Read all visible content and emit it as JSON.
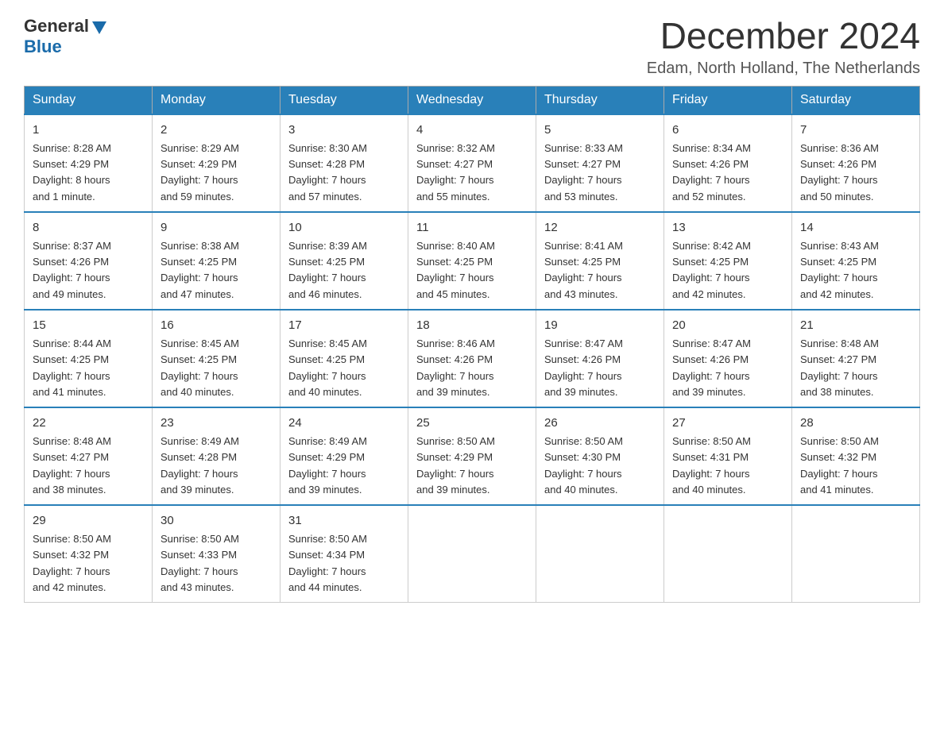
{
  "header": {
    "logo_general": "General",
    "logo_blue": "Blue",
    "month_title": "December 2024",
    "location": "Edam, North Holland, The Netherlands"
  },
  "columns": [
    "Sunday",
    "Monday",
    "Tuesday",
    "Wednesday",
    "Thursday",
    "Friday",
    "Saturday"
  ],
  "weeks": [
    [
      {
        "day": "1",
        "sunrise": "Sunrise: 8:28 AM",
        "sunset": "Sunset: 4:29 PM",
        "daylight": "Daylight: 8 hours",
        "daylight2": "and 1 minute."
      },
      {
        "day": "2",
        "sunrise": "Sunrise: 8:29 AM",
        "sunset": "Sunset: 4:29 PM",
        "daylight": "Daylight: 7 hours",
        "daylight2": "and 59 minutes."
      },
      {
        "day": "3",
        "sunrise": "Sunrise: 8:30 AM",
        "sunset": "Sunset: 4:28 PM",
        "daylight": "Daylight: 7 hours",
        "daylight2": "and 57 minutes."
      },
      {
        "day": "4",
        "sunrise": "Sunrise: 8:32 AM",
        "sunset": "Sunset: 4:27 PM",
        "daylight": "Daylight: 7 hours",
        "daylight2": "and 55 minutes."
      },
      {
        "day": "5",
        "sunrise": "Sunrise: 8:33 AM",
        "sunset": "Sunset: 4:27 PM",
        "daylight": "Daylight: 7 hours",
        "daylight2": "and 53 minutes."
      },
      {
        "day": "6",
        "sunrise": "Sunrise: 8:34 AM",
        "sunset": "Sunset: 4:26 PM",
        "daylight": "Daylight: 7 hours",
        "daylight2": "and 52 minutes."
      },
      {
        "day": "7",
        "sunrise": "Sunrise: 8:36 AM",
        "sunset": "Sunset: 4:26 PM",
        "daylight": "Daylight: 7 hours",
        "daylight2": "and 50 minutes."
      }
    ],
    [
      {
        "day": "8",
        "sunrise": "Sunrise: 8:37 AM",
        "sunset": "Sunset: 4:26 PM",
        "daylight": "Daylight: 7 hours",
        "daylight2": "and 49 minutes."
      },
      {
        "day": "9",
        "sunrise": "Sunrise: 8:38 AM",
        "sunset": "Sunset: 4:25 PM",
        "daylight": "Daylight: 7 hours",
        "daylight2": "and 47 minutes."
      },
      {
        "day": "10",
        "sunrise": "Sunrise: 8:39 AM",
        "sunset": "Sunset: 4:25 PM",
        "daylight": "Daylight: 7 hours",
        "daylight2": "and 46 minutes."
      },
      {
        "day": "11",
        "sunrise": "Sunrise: 8:40 AM",
        "sunset": "Sunset: 4:25 PM",
        "daylight": "Daylight: 7 hours",
        "daylight2": "and 45 minutes."
      },
      {
        "day": "12",
        "sunrise": "Sunrise: 8:41 AM",
        "sunset": "Sunset: 4:25 PM",
        "daylight": "Daylight: 7 hours",
        "daylight2": "and 43 minutes."
      },
      {
        "day": "13",
        "sunrise": "Sunrise: 8:42 AM",
        "sunset": "Sunset: 4:25 PM",
        "daylight": "Daylight: 7 hours",
        "daylight2": "and 42 minutes."
      },
      {
        "day": "14",
        "sunrise": "Sunrise: 8:43 AM",
        "sunset": "Sunset: 4:25 PM",
        "daylight": "Daylight: 7 hours",
        "daylight2": "and 42 minutes."
      }
    ],
    [
      {
        "day": "15",
        "sunrise": "Sunrise: 8:44 AM",
        "sunset": "Sunset: 4:25 PM",
        "daylight": "Daylight: 7 hours",
        "daylight2": "and 41 minutes."
      },
      {
        "day": "16",
        "sunrise": "Sunrise: 8:45 AM",
        "sunset": "Sunset: 4:25 PM",
        "daylight": "Daylight: 7 hours",
        "daylight2": "and 40 minutes."
      },
      {
        "day": "17",
        "sunrise": "Sunrise: 8:45 AM",
        "sunset": "Sunset: 4:25 PM",
        "daylight": "Daylight: 7 hours",
        "daylight2": "and 40 minutes."
      },
      {
        "day": "18",
        "sunrise": "Sunrise: 8:46 AM",
        "sunset": "Sunset: 4:26 PM",
        "daylight": "Daylight: 7 hours",
        "daylight2": "and 39 minutes."
      },
      {
        "day": "19",
        "sunrise": "Sunrise: 8:47 AM",
        "sunset": "Sunset: 4:26 PM",
        "daylight": "Daylight: 7 hours",
        "daylight2": "and 39 minutes."
      },
      {
        "day": "20",
        "sunrise": "Sunrise: 8:47 AM",
        "sunset": "Sunset: 4:26 PM",
        "daylight": "Daylight: 7 hours",
        "daylight2": "and 39 minutes."
      },
      {
        "day": "21",
        "sunrise": "Sunrise: 8:48 AM",
        "sunset": "Sunset: 4:27 PM",
        "daylight": "Daylight: 7 hours",
        "daylight2": "and 38 minutes."
      }
    ],
    [
      {
        "day": "22",
        "sunrise": "Sunrise: 8:48 AM",
        "sunset": "Sunset: 4:27 PM",
        "daylight": "Daylight: 7 hours",
        "daylight2": "and 38 minutes."
      },
      {
        "day": "23",
        "sunrise": "Sunrise: 8:49 AM",
        "sunset": "Sunset: 4:28 PM",
        "daylight": "Daylight: 7 hours",
        "daylight2": "and 39 minutes."
      },
      {
        "day": "24",
        "sunrise": "Sunrise: 8:49 AM",
        "sunset": "Sunset: 4:29 PM",
        "daylight": "Daylight: 7 hours",
        "daylight2": "and 39 minutes."
      },
      {
        "day": "25",
        "sunrise": "Sunrise: 8:50 AM",
        "sunset": "Sunset: 4:29 PM",
        "daylight": "Daylight: 7 hours",
        "daylight2": "and 39 minutes."
      },
      {
        "day": "26",
        "sunrise": "Sunrise: 8:50 AM",
        "sunset": "Sunset: 4:30 PM",
        "daylight": "Daylight: 7 hours",
        "daylight2": "and 40 minutes."
      },
      {
        "day": "27",
        "sunrise": "Sunrise: 8:50 AM",
        "sunset": "Sunset: 4:31 PM",
        "daylight": "Daylight: 7 hours",
        "daylight2": "and 40 minutes."
      },
      {
        "day": "28",
        "sunrise": "Sunrise: 8:50 AM",
        "sunset": "Sunset: 4:32 PM",
        "daylight": "Daylight: 7 hours",
        "daylight2": "and 41 minutes."
      }
    ],
    [
      {
        "day": "29",
        "sunrise": "Sunrise: 8:50 AM",
        "sunset": "Sunset: 4:32 PM",
        "daylight": "Daylight: 7 hours",
        "daylight2": "and 42 minutes."
      },
      {
        "day": "30",
        "sunrise": "Sunrise: 8:50 AM",
        "sunset": "Sunset: 4:33 PM",
        "daylight": "Daylight: 7 hours",
        "daylight2": "and 43 minutes."
      },
      {
        "day": "31",
        "sunrise": "Sunrise: 8:50 AM",
        "sunset": "Sunset: 4:34 PM",
        "daylight": "Daylight: 7 hours",
        "daylight2": "and 44 minutes."
      },
      null,
      null,
      null,
      null
    ]
  ]
}
